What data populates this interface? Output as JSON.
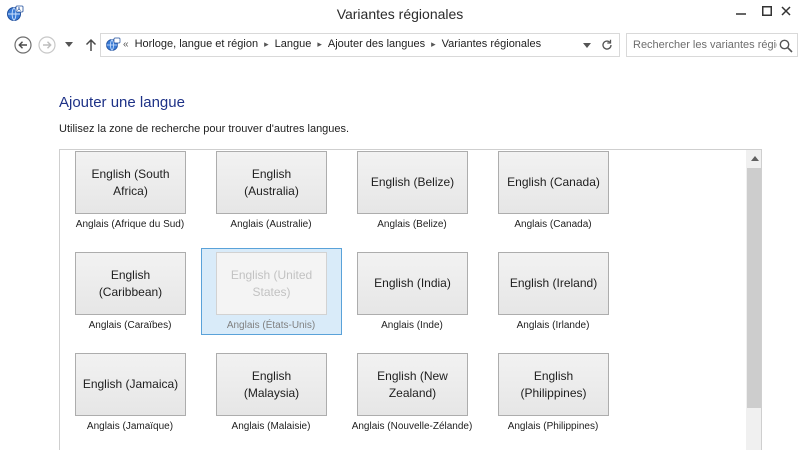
{
  "window": {
    "title": "Variantes régionales",
    "app_icon": "language-globe-icon"
  },
  "nav": {
    "back_icon": "back-arrow-icon",
    "forward_icon": "forward-arrow-icon",
    "up_icon": "up-arrow-icon",
    "overflow": "«",
    "breadcrumbs": [
      "Horloge, langue et région",
      "Langue",
      "Ajouter des langues",
      "Variantes régionales"
    ],
    "search_placeholder": "Rechercher les variantes régio..."
  },
  "content": {
    "title": "Ajouter une langue",
    "instructions": "Utilisez la zone de recherche pour trouver d'autres langues."
  },
  "languages": [
    {
      "name": "English (South Africa)",
      "caption": "Anglais (Afrique du Sud)"
    },
    {
      "name": "English (Australia)",
      "caption": "Anglais (Australie)"
    },
    {
      "name": "English (Belize)",
      "caption": "Anglais (Belize)"
    },
    {
      "name": "English (Canada)",
      "caption": "Anglais (Canada)"
    },
    {
      "name": "English (Caribbean)",
      "caption": "Anglais (Caraïbes)"
    },
    {
      "name": "English (United States)",
      "caption": "Anglais (États-Unis)",
      "selected": true
    },
    {
      "name": "English (India)",
      "caption": "Anglais (Inde)"
    },
    {
      "name": "English (Ireland)",
      "caption": "Anglais (Irlande)"
    },
    {
      "name": "English (Jamaica)",
      "caption": "Anglais (Jamaïque)"
    },
    {
      "name": "English (Malaysia)",
      "caption": "Anglais (Malaisie)"
    },
    {
      "name": "English (New Zealand)",
      "caption": "Anglais (Nouvelle-Zélande)"
    },
    {
      "name": "English (Philippines)",
      "caption": "Anglais (Philippines)"
    }
  ],
  "colors": {
    "title_blue": "#1e3287",
    "selection_fill": "#d9ebf9",
    "selection_border": "#5aa2d9"
  }
}
